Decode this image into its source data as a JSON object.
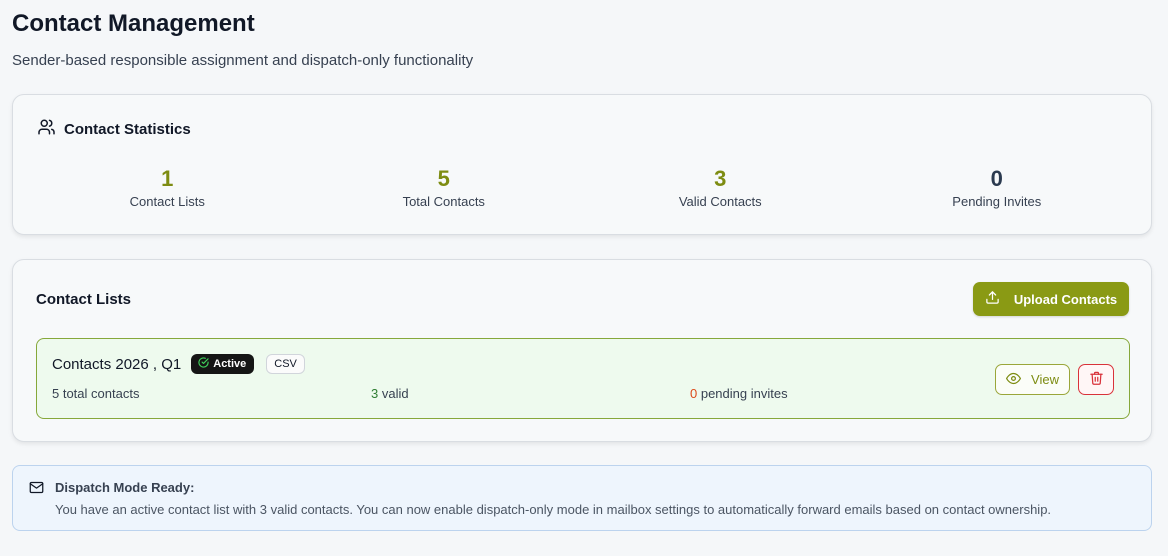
{
  "header": {
    "title": "Contact Management",
    "subtitle": "Sender-based responsible assignment and dispatch-only functionality"
  },
  "stats": {
    "heading": "Contact Statistics",
    "heading_icon": "users-icon",
    "items": [
      {
        "value": "1",
        "label": "Contact Lists",
        "color": "#7d8c12"
      },
      {
        "value": "5",
        "label": "Total Contacts",
        "color": "#7d8c12"
      },
      {
        "value": "3",
        "label": "Valid Contacts",
        "color": "#7d8c12"
      },
      {
        "value": "0",
        "label": "Pending Invites",
        "color": "#2b3a4f"
      }
    ]
  },
  "lists": {
    "title": "Contact Lists",
    "upload_label": "Upload Contacts",
    "upload_icon": "upload-icon",
    "items": [
      {
        "name": "Contacts 2026 , Q1",
        "status": "Active",
        "format": "CSV",
        "total": "5 total contacts",
        "valid_count": "3",
        "valid_suffix": " valid",
        "pending_count": "0",
        "pending_suffix": " pending invites",
        "view_label": "View"
      }
    ]
  },
  "alert": {
    "icon": "mail-icon",
    "title": "Dispatch Mode Ready:",
    "text": "You have an active contact list with 3 valid contacts. You can now enable dispatch-only mode in mailbox settings to automatically forward emails based on contact ownership."
  },
  "colors": {
    "accent": "#8a9a14",
    "danger": "#d9323a",
    "success": "#2f7d32"
  }
}
